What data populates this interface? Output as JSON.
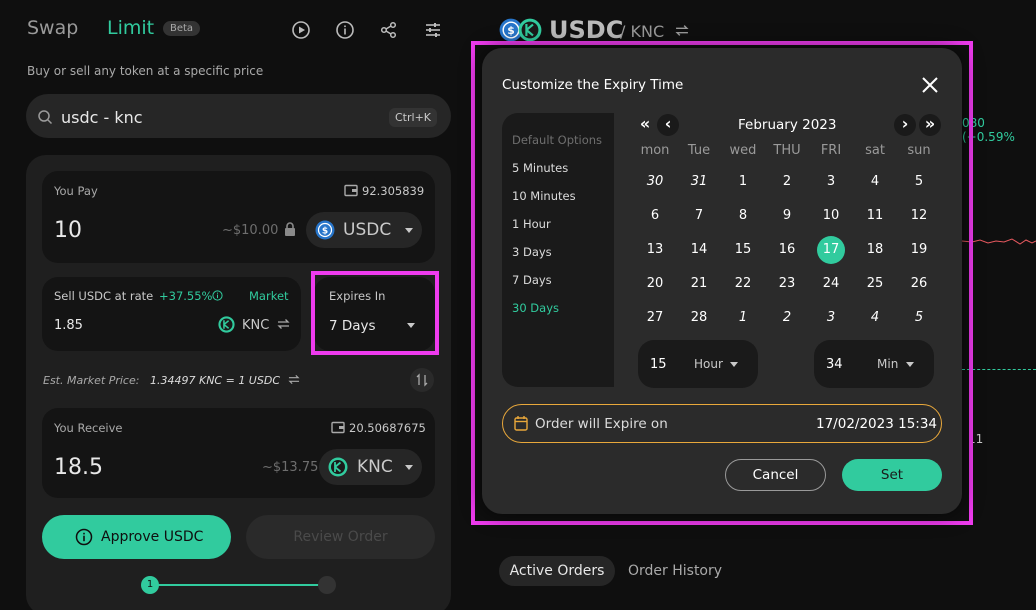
{
  "header": {
    "tab_swap": "Swap",
    "tab_limit": "Limit",
    "beta": "Beta",
    "subtitle": "Buy or sell any token at a specific price"
  },
  "search": {
    "value": "usdc - knc",
    "shortcut": "Ctrl+K"
  },
  "pay": {
    "label": "You Pay",
    "balance": "92.305839",
    "amount": "10",
    "usd": "~$10.00",
    "token": "USDC"
  },
  "rate": {
    "label": "Sell USDC at rate",
    "change": "+37.55%",
    "market": "Market",
    "value": "1.85",
    "token": "KNC"
  },
  "expires": {
    "label": "Expires In",
    "value": "7 Days"
  },
  "market_price": {
    "prefix": "Est. Market Price:",
    "value": "1.34497 KNC = 1 USDC"
  },
  "receive": {
    "label": "You Receive",
    "balance": "20.50687675",
    "amount": "18.5",
    "usd": "~$13.75",
    "token": "KNC"
  },
  "actions": {
    "approve": "Approve USDC",
    "review": "Review Order",
    "step1": "1"
  },
  "pair": {
    "base": "USDC",
    "quote": "/ KNC",
    "peek_change": "080 (+0.59%",
    "peek_axis": "11"
  },
  "orders": {
    "active": "Active Orders",
    "history": "Order History"
  },
  "modal": {
    "title": "Customize the Expiry Time",
    "options_head": "Default Options",
    "options": [
      "5 Minutes",
      "10 Minutes",
      "1 Hour",
      "3 Days",
      "7 Days",
      "30 Days"
    ],
    "calendar": {
      "month": "February 2023",
      "weekdays": [
        "mon",
        "Tue",
        "wed",
        "THU",
        "FRI",
        "sat",
        "sun"
      ],
      "rows": [
        [
          "30",
          "31",
          "1",
          "2",
          "3",
          "4",
          "5"
        ],
        [
          "6",
          "7",
          "8",
          "9",
          "10",
          "11",
          "12"
        ],
        [
          "13",
          "14",
          "15",
          "16",
          "17",
          "18",
          "19"
        ],
        [
          "20",
          "21",
          "22",
          "23",
          "24",
          "25",
          "26"
        ],
        [
          "27",
          "28",
          "1",
          "2",
          "3",
          "4",
          "5"
        ]
      ]
    },
    "hour_value": "15",
    "hour_unit": "Hour",
    "min_value": "34",
    "min_unit": "Min",
    "expire_label": "Order will Expire on",
    "expire_value": "17/02/2023 15:34",
    "cancel": "Cancel",
    "set": "Set"
  },
  "colors": {
    "accent": "#31cb9e",
    "highlight": "#ee3bee",
    "warning": "#e9a83b"
  }
}
